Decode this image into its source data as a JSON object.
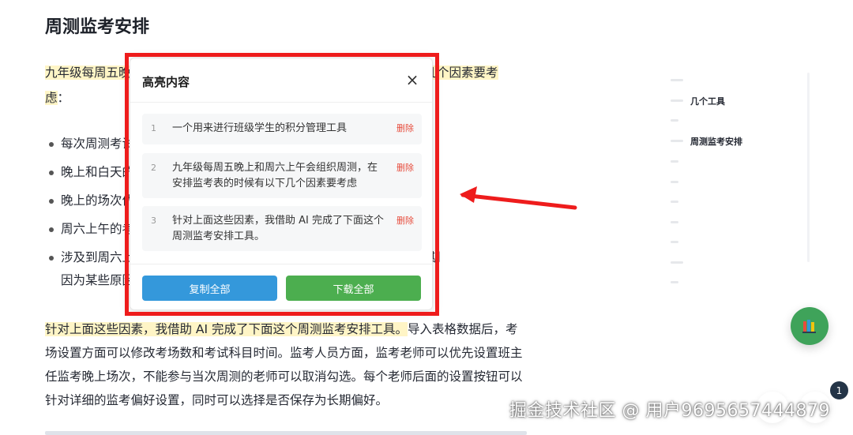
{
  "article": {
    "title": "周测监考安排",
    "para1_highlight": "九年级每周五晚上和周六上午会组织周测，在安排监考表的时候有以下几个因素要考虑",
    "para1_tail": "：",
    "bullets": [
      {
        "text": "每次周测考试科目和时间不一致；"
      },
      {
        "text": "晚上和白天的考场数量不一样，需要每位老师平均分配考场次数；"
      },
      {
        "text": "晚上的场次优先安排班主任监考；"
      },
      {
        "text": "周六上午的考试科目和周五晚上的考试科目、时间都不一致；"
      },
      {
        "text": "涉及到周六上午的考试需要平均分配考场次数，同时有部分老师会长期",
        "cont": "因为某些原因不能参与监考。"
      }
    ],
    "para2_highlight": "针对上面这些因素，我借助 AI 完成了下面这个周测监考安排工具。",
    "para2_rest": "导入表格数据后，考场设置方面可以修改考场数和考试科目时间。监考人员方面，监考老师可以优先设置班主任监考晚上场次，不能参与当次周测的老师可以取消勾选。每个老师后面的设置按钮可以针对详细的监考偏好设置，同时可以选择是否保存为长期偏好。"
  },
  "toc": {
    "items": [
      {
        "label": "几个工具"
      },
      {
        "label": "周测监考安排"
      }
    ]
  },
  "modal": {
    "title": "高亮内容",
    "close_symbol": "×",
    "delete_label": "删除",
    "items": [
      {
        "index": "1",
        "text": "一个用来进行班级学生的积分管理工具"
      },
      {
        "index": "2",
        "text": "九年级每周五晚上和周六上午会组织周测，在安排监考表的时候有以下几个因素要考虑"
      },
      {
        "index": "3",
        "text": "针对上面这些因素，我借助 AI 完成了下面这个周测监考安排工具。"
      }
    ],
    "copy_all_label": "复制全部",
    "download_all_label": "下载全部"
  },
  "notification_count": "1",
  "watermark": "掘金技术社区 @ 用户9695657444879",
  "colors": {
    "highlight": "#fff5c6",
    "annotation_red": "#ee1c1c",
    "copy_button": "#3498db",
    "download_button": "#4cae4f",
    "delete_text": "#e74c3c",
    "fab_green": "#3fa35a"
  }
}
